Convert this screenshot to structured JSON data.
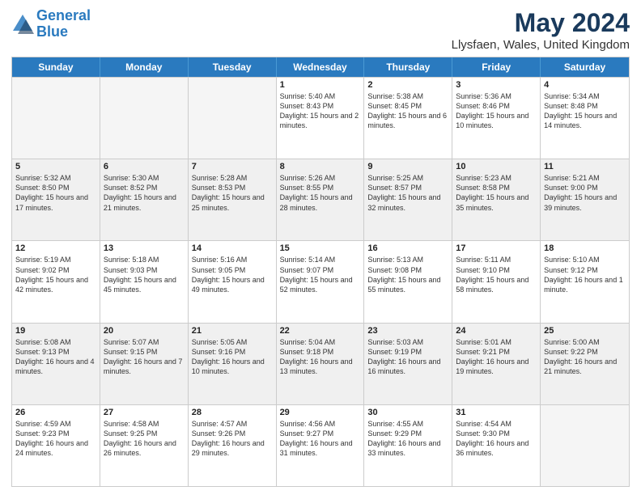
{
  "header": {
    "logo_line1": "General",
    "logo_line2": "Blue",
    "month": "May 2024",
    "location": "Llysfaen, Wales, United Kingdom"
  },
  "weekdays": [
    "Sunday",
    "Monday",
    "Tuesday",
    "Wednesday",
    "Thursday",
    "Friday",
    "Saturday"
  ],
  "rows": [
    [
      {
        "day": "",
        "info": "",
        "empty": true
      },
      {
        "day": "",
        "info": "",
        "empty": true
      },
      {
        "day": "",
        "info": "",
        "empty": true
      },
      {
        "day": "1",
        "info": "Sunrise: 5:40 AM\nSunset: 8:43 PM\nDaylight: 15 hours and 2 minutes.",
        "empty": false
      },
      {
        "day": "2",
        "info": "Sunrise: 5:38 AM\nSunset: 8:45 PM\nDaylight: 15 hours and 6 minutes.",
        "empty": false
      },
      {
        "day": "3",
        "info": "Sunrise: 5:36 AM\nSunset: 8:46 PM\nDaylight: 15 hours and 10 minutes.",
        "empty": false
      },
      {
        "day": "4",
        "info": "Sunrise: 5:34 AM\nSunset: 8:48 PM\nDaylight: 15 hours and 14 minutes.",
        "empty": false
      }
    ],
    [
      {
        "day": "5",
        "info": "Sunrise: 5:32 AM\nSunset: 8:50 PM\nDaylight: 15 hours and 17 minutes.",
        "empty": false
      },
      {
        "day": "6",
        "info": "Sunrise: 5:30 AM\nSunset: 8:52 PM\nDaylight: 15 hours and 21 minutes.",
        "empty": false
      },
      {
        "day": "7",
        "info": "Sunrise: 5:28 AM\nSunset: 8:53 PM\nDaylight: 15 hours and 25 minutes.",
        "empty": false
      },
      {
        "day": "8",
        "info": "Sunrise: 5:26 AM\nSunset: 8:55 PM\nDaylight: 15 hours and 28 minutes.",
        "empty": false
      },
      {
        "day": "9",
        "info": "Sunrise: 5:25 AM\nSunset: 8:57 PM\nDaylight: 15 hours and 32 minutes.",
        "empty": false
      },
      {
        "day": "10",
        "info": "Sunrise: 5:23 AM\nSunset: 8:58 PM\nDaylight: 15 hours and 35 minutes.",
        "empty": false
      },
      {
        "day": "11",
        "info": "Sunrise: 5:21 AM\nSunset: 9:00 PM\nDaylight: 15 hours and 39 minutes.",
        "empty": false
      }
    ],
    [
      {
        "day": "12",
        "info": "Sunrise: 5:19 AM\nSunset: 9:02 PM\nDaylight: 15 hours and 42 minutes.",
        "empty": false
      },
      {
        "day": "13",
        "info": "Sunrise: 5:18 AM\nSunset: 9:03 PM\nDaylight: 15 hours and 45 minutes.",
        "empty": false
      },
      {
        "day": "14",
        "info": "Sunrise: 5:16 AM\nSunset: 9:05 PM\nDaylight: 15 hours and 49 minutes.",
        "empty": false
      },
      {
        "day": "15",
        "info": "Sunrise: 5:14 AM\nSunset: 9:07 PM\nDaylight: 15 hours and 52 minutes.",
        "empty": false
      },
      {
        "day": "16",
        "info": "Sunrise: 5:13 AM\nSunset: 9:08 PM\nDaylight: 15 hours and 55 minutes.",
        "empty": false
      },
      {
        "day": "17",
        "info": "Sunrise: 5:11 AM\nSunset: 9:10 PM\nDaylight: 15 hours and 58 minutes.",
        "empty": false
      },
      {
        "day": "18",
        "info": "Sunrise: 5:10 AM\nSunset: 9:12 PM\nDaylight: 16 hours and 1 minute.",
        "empty": false
      }
    ],
    [
      {
        "day": "19",
        "info": "Sunrise: 5:08 AM\nSunset: 9:13 PM\nDaylight: 16 hours and 4 minutes.",
        "empty": false
      },
      {
        "day": "20",
        "info": "Sunrise: 5:07 AM\nSunset: 9:15 PM\nDaylight: 16 hours and 7 minutes.",
        "empty": false
      },
      {
        "day": "21",
        "info": "Sunrise: 5:05 AM\nSunset: 9:16 PM\nDaylight: 16 hours and 10 minutes.",
        "empty": false
      },
      {
        "day": "22",
        "info": "Sunrise: 5:04 AM\nSunset: 9:18 PM\nDaylight: 16 hours and 13 minutes.",
        "empty": false
      },
      {
        "day": "23",
        "info": "Sunrise: 5:03 AM\nSunset: 9:19 PM\nDaylight: 16 hours and 16 minutes.",
        "empty": false
      },
      {
        "day": "24",
        "info": "Sunrise: 5:01 AM\nSunset: 9:21 PM\nDaylight: 16 hours and 19 minutes.",
        "empty": false
      },
      {
        "day": "25",
        "info": "Sunrise: 5:00 AM\nSunset: 9:22 PM\nDaylight: 16 hours and 21 minutes.",
        "empty": false
      }
    ],
    [
      {
        "day": "26",
        "info": "Sunrise: 4:59 AM\nSunset: 9:23 PM\nDaylight: 16 hours and 24 minutes.",
        "empty": false
      },
      {
        "day": "27",
        "info": "Sunrise: 4:58 AM\nSunset: 9:25 PM\nDaylight: 16 hours and 26 minutes.",
        "empty": false
      },
      {
        "day": "28",
        "info": "Sunrise: 4:57 AM\nSunset: 9:26 PM\nDaylight: 16 hours and 29 minutes.",
        "empty": false
      },
      {
        "day": "29",
        "info": "Sunrise: 4:56 AM\nSunset: 9:27 PM\nDaylight: 16 hours and 31 minutes.",
        "empty": false
      },
      {
        "day": "30",
        "info": "Sunrise: 4:55 AM\nSunset: 9:29 PM\nDaylight: 16 hours and 33 minutes.",
        "empty": false
      },
      {
        "day": "31",
        "info": "Sunrise: 4:54 AM\nSunset: 9:30 PM\nDaylight: 16 hours and 36 minutes.",
        "empty": false
      },
      {
        "day": "",
        "info": "",
        "empty": true
      }
    ]
  ]
}
